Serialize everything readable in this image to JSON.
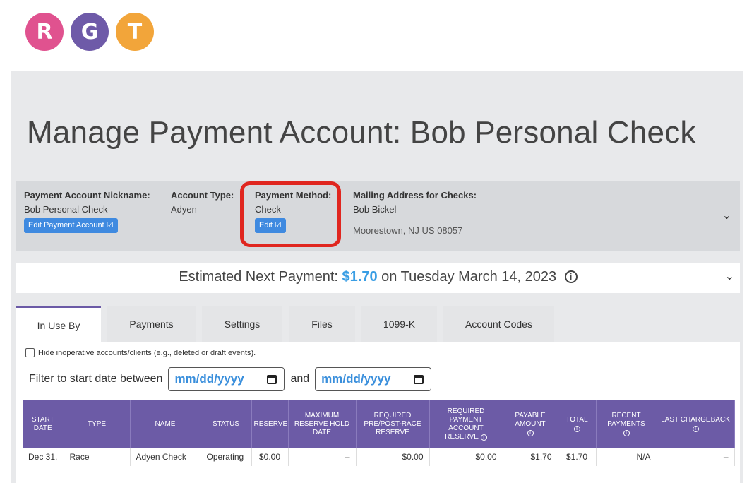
{
  "logo": {
    "letters": [
      "R",
      "G",
      "T"
    ],
    "colors": [
      "#e0528f",
      "#6e5aa8",
      "#f2a53a"
    ]
  },
  "page_title": "Manage Payment Account: Bob Personal Check",
  "account_info": {
    "nickname_label": "Payment Account Nickname:",
    "nickname_value": "Bob Personal Check",
    "edit_account_button": "Edit Payment Account",
    "type_label": "Account Type:",
    "type_value": "Adyen",
    "method_label": "Payment Method:",
    "method_value": "Check",
    "edit_method_button": "Edit",
    "mailing_label": "Mailing Address for Checks:",
    "mailing_name": "Bob Bickel",
    "mailing_street": "",
    "mailing_city": "Moorestown, NJ US 08057"
  },
  "estimate": {
    "prefix": "Estimated Next Payment:",
    "amount": "$1.70",
    "suffix": "on Tuesday March 14, 2023"
  },
  "tabs": [
    "In Use By",
    "Payments",
    "Settings",
    "Files",
    "1099-K",
    "Account Codes"
  ],
  "active_tab": "In Use By",
  "hide_inoperative_label": "Hide inoperative accounts/clients (e.g., deleted or draft events).",
  "filter": {
    "label": "Filter to start date between",
    "and_label": "and",
    "start_placeholder": "mm/dd/yyyy",
    "end_placeholder": "mm/dd/yyyy"
  },
  "table": {
    "headers": [
      "START DATE",
      "TYPE",
      "NAME",
      "STATUS",
      "RESERVE",
      "MAXIMUM RESERVE HOLD DATE",
      "REQUIRED PRE/POST-RACE RESERVE",
      "REQUIRED PAYMENT ACCOUNT RESERVE",
      "PAYABLE AMOUNT",
      "TOTAL",
      "RECENT PAYMENTS",
      "LAST CHARGEBACK"
    ],
    "rows": [
      [
        "Dec 31,",
        "Race",
        "Adyen Check",
        "Operating",
        "$0.00",
        "–",
        "$0.00",
        "$0.00",
        "$1.70",
        "$1.70",
        "N/A",
        "–"
      ]
    ]
  },
  "colors": {
    "accent": "#6c5ba6",
    "button": "#3f8ae0",
    "highlight": "#e0261f",
    "amount": "#3a9ee4"
  }
}
